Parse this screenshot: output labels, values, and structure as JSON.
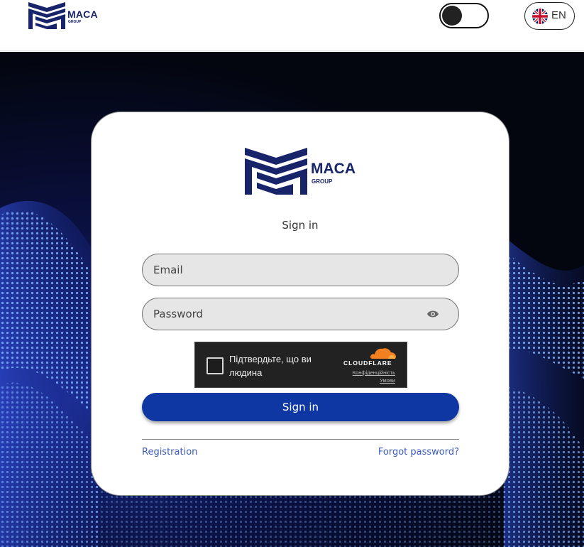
{
  "header": {
    "logo": {
      "brand": "MACA",
      "sub": "GROUP"
    },
    "theme_toggle": {
      "state": "light"
    },
    "language": {
      "code": "EN",
      "flag": "uk-flag-icon"
    }
  },
  "card": {
    "logo": {
      "brand": "MACA",
      "sub": "GROUP"
    },
    "title": "Sign in",
    "email": {
      "placeholder": "Email",
      "value": ""
    },
    "password": {
      "placeholder": "Password",
      "value": ""
    },
    "captcha": {
      "label": "Підтвердьте, що ви людина",
      "brand": "CLOUDFLARE",
      "privacy": "Конфіденційність",
      "terms": "Умови"
    },
    "signin_button": "Sign in",
    "registration_link": "Registration",
    "forgot_link": "Forgot password?"
  },
  "colors": {
    "brand_navy": "#17246a",
    "button_blue": "#0f37a4",
    "link_blue": "#3b5ac0",
    "cloudflare_orange": "#f38020"
  }
}
